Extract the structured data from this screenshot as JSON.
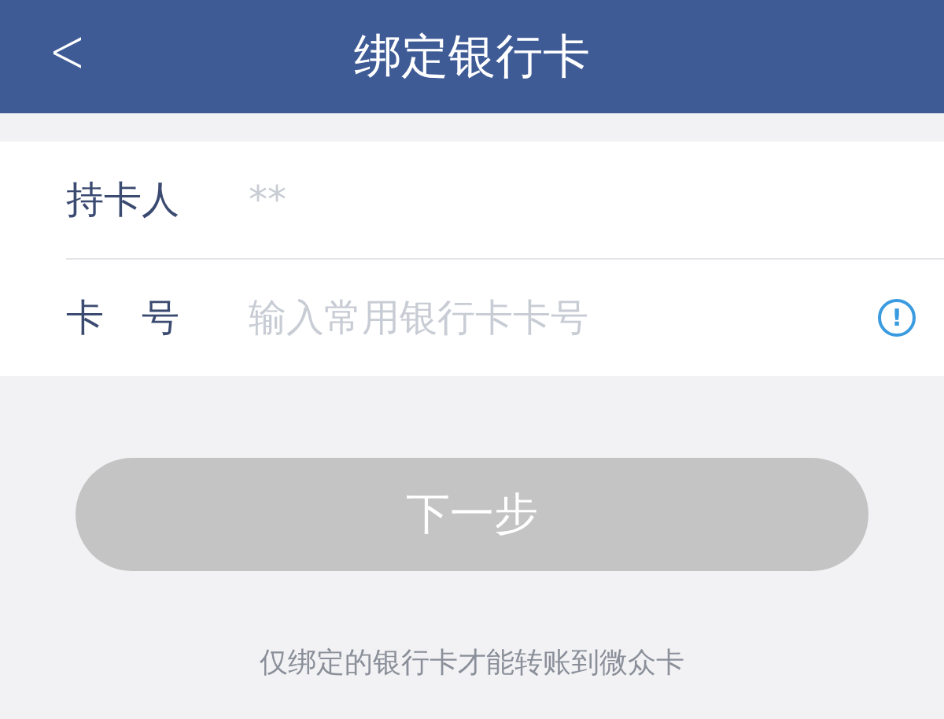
{
  "header": {
    "back_icon": "<",
    "title": "绑定银行卡"
  },
  "form": [
    {
      "kind": "name",
      "label": "持卡人",
      "value": "**"
    },
    {
      "kind": "card",
      "label": "卡　号",
      "placeholder": "输入常用银行卡卡号",
      "info_icon": "!"
    }
  ],
  "next_button": {
    "label": "下一步",
    "disabled": true
  },
  "note": "仅绑定的银行卡才能转账到微众卡"
}
